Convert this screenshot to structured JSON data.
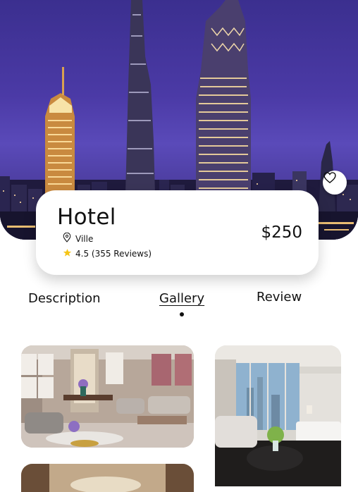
{
  "hotel": {
    "name": "Hotel",
    "location": "Ville",
    "rating_text": "4.5 (355 Reviews)",
    "price": "$250"
  },
  "tabs": {
    "description": "Description",
    "gallery": "Gallery",
    "review": "Review",
    "active": "gallery"
  },
  "icons": {
    "favorite": "heart-icon",
    "location": "location-pin-icon",
    "rating": "star-icon"
  },
  "colors": {
    "star": "#f5c518",
    "text": "#111111"
  }
}
